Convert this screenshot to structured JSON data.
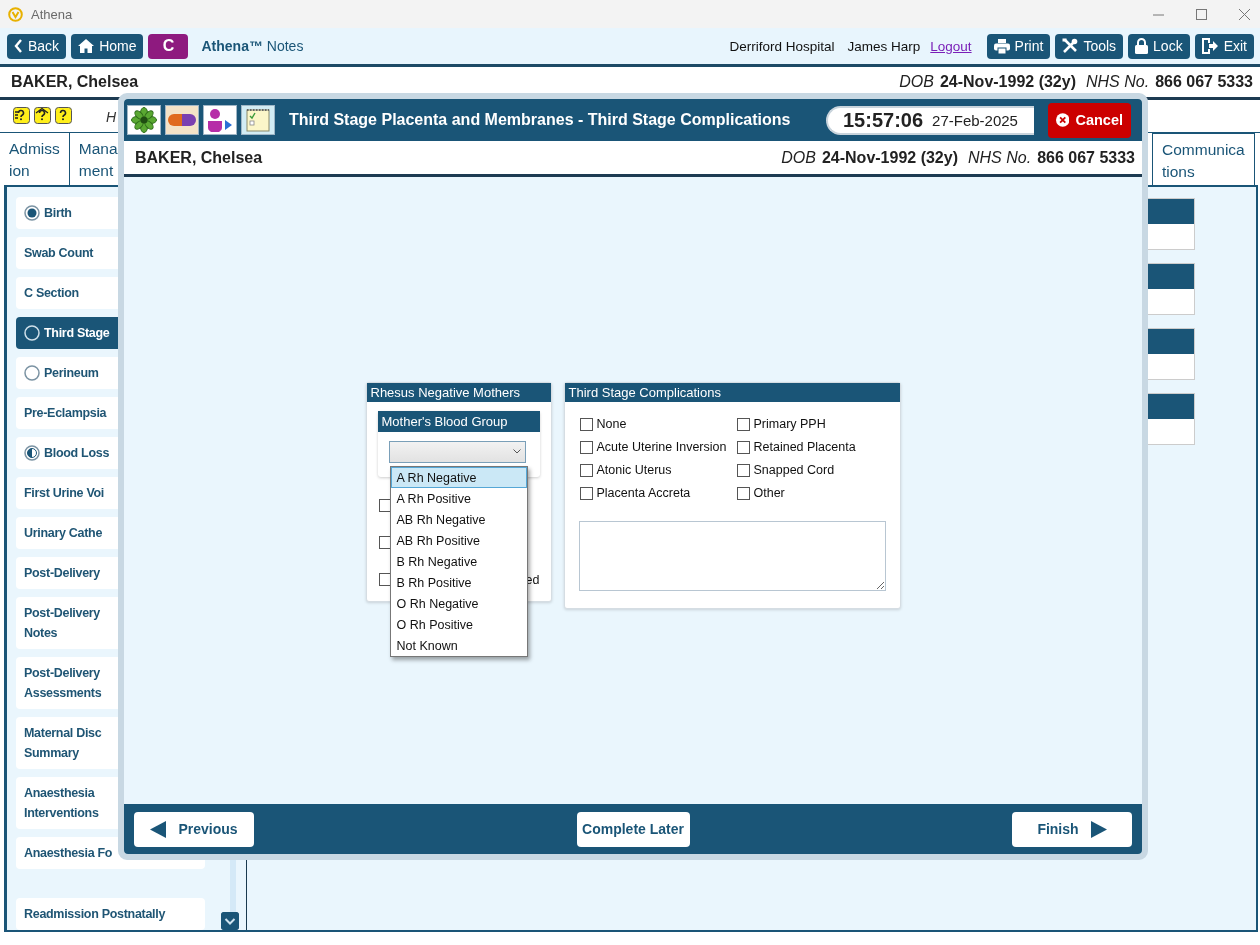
{
  "window": {
    "title": "Athena"
  },
  "toolbar": {
    "nav_buttons": [
      {
        "label": "Back"
      },
      {
        "label": "Home"
      }
    ],
    "patient_badge": "C",
    "brand": "**Athena™** Notes",
    "location": "Derriford Hospital",
    "user": "James Harp",
    "logout_link": "Logout",
    "action_buttons": [
      {
        "label": "Print"
      },
      {
        "label": "Tools"
      },
      {
        "label": "Lock"
      },
      {
        "label": "Exit"
      }
    ]
  },
  "patient_banner": {
    "name": "BAKER, Chelsea",
    "dob_label": "DOB",
    "dob": "24-Nov-1992 (32y)",
    "nhs_label": "NHS No.",
    "nhs": "866 067 5333"
  },
  "note_letter": "H",
  "tabs": [
    {
      "lines": [
        "Admiss",
        "ion"
      ],
      "selected": false
    },
    {
      "lines": [
        "Mana",
        "ment"
      ],
      "selected": false
    },
    {
      "lines": [
        "Communica",
        "tions"
      ],
      "selected": false
    }
  ],
  "sidebar": {
    "items": [
      {
        "lines": [
          "Birth"
        ],
        "kind": "complete",
        "selected": false
      },
      {
        "lines": [
          "Swab Count"
        ],
        "kind": "none",
        "selected": false
      },
      {
        "lines": [
          "C Section"
        ],
        "kind": "none",
        "selected": false
      },
      {
        "lines": [
          "Third Stage"
        ],
        "kind": "empty",
        "selected": true
      },
      {
        "lines": [
          "Perineum"
        ],
        "kind": "empty",
        "selected": false
      },
      {
        "lines": [
          "Pre-Eclampsia"
        ],
        "kind": "none",
        "selected": false
      },
      {
        "lines": [
          "Blood Loss"
        ],
        "kind": "partial",
        "selected": false
      },
      {
        "lines": [
          "First Urine Voi"
        ],
        "kind": "none",
        "selected": false
      },
      {
        "lines": [
          "Urinary Cathe"
        ],
        "kind": "none",
        "selected": false
      },
      {
        "lines": [
          "Post-Delivery"
        ],
        "kind": "none",
        "selected": false
      },
      {
        "lines": [
          "Post-Delivery",
          "Notes"
        ],
        "kind": "none",
        "selected": false
      },
      {
        "lines": [
          "Post-Delivery",
          "Assessments"
        ],
        "kind": "none",
        "selected": false
      },
      {
        "lines": [
          "Maternal Disc",
          "Summary"
        ],
        "kind": "none",
        "selected": false
      },
      {
        "lines": [
          "Anaesthesia",
          "Interventions"
        ],
        "kind": "none",
        "selected": false
      },
      {
        "lines": [
          "Anaesthesia Fo"
        ],
        "kind": "none",
        "selected": false
      },
      {
        "lines": [
          "Readmission Postnatally"
        ],
        "kind": "none",
        "selected": false
      }
    ]
  },
  "modal": {
    "title": "Third Stage Placenta and Membranes - Third Stage Complications",
    "time": "15:57:06",
    "date": "27-Feb-2025",
    "cancel_button": "Cancel",
    "patient_banner": {
      "name": "BAKER, Chelsea",
      "dob_label": "DOB",
      "dob": "24-Nov-1992 (32y)",
      "nhs_label": "NHS No.",
      "nhs": "866 067 5333"
    },
    "rhesus_panel": {
      "title": "Rhesus Negative Mothers",
      "blood_group": {
        "title": "Mother's Blood Group",
        "open": true,
        "options": [
          {
            "label": "A Rh Negative",
            "selected": true
          },
          {
            "label": "A Rh Positive",
            "selected": false
          },
          {
            "label": "AB Rh Negative",
            "selected": false
          },
          {
            "label": "AB Rh Positive",
            "selected": false
          },
          {
            "label": "B Rh Negative",
            "selected": false
          },
          {
            "label": "B Rh Positive",
            "selected": false
          },
          {
            "label": "O Rh Negative",
            "selected": false
          },
          {
            "label": "O Rh Positive",
            "selected": false
          },
          {
            "label": "Not Known",
            "selected": false
          }
        ]
      },
      "checks": [
        {
          "checked": false
        },
        {
          "checked": false
        },
        {
          "checked": false,
          "label": "ed"
        }
      ]
    },
    "complications_panel": {
      "title": "Third Stage Complications",
      "options": [
        {
          "label": "None",
          "checked": false
        },
        {
          "label": "Primary PPH",
          "checked": false
        },
        {
          "label": "Acute Uterine Inversion",
          "checked": false
        },
        {
          "label": "Retained Placenta",
          "checked": false
        },
        {
          "label": "Atonic Uterus",
          "checked": false
        },
        {
          "label": "Snapped Cord",
          "checked": false
        },
        {
          "label": "Placenta Accreta",
          "checked": false
        },
        {
          "label": "Other",
          "checked": false
        }
      ]
    },
    "footer": {
      "previous_button": "Previous",
      "complete_later_button": "Complete Later",
      "finish_button": "Finish"
    }
  }
}
